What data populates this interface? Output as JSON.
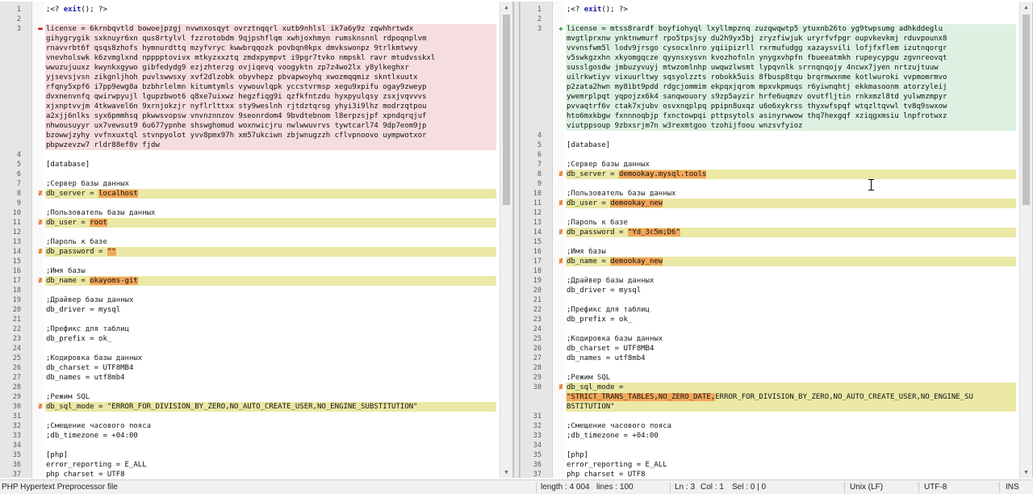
{
  "left": {
    "lines": [
      {
        "n": "1",
        "marker": "",
        "bg": "",
        "segs": [
          {
            "t": ";<? ",
            "c": "php-tag"
          },
          {
            "t": "exit",
            "c": "kw"
          },
          {
            "t": "(); ?>",
            "c": "php-tag"
          }
        ]
      },
      {
        "n": "2",
        "marker": "",
        "bg": "",
        "segs": []
      },
      {
        "n": "3",
        "marker": "removed",
        "bg": "removed",
        "segs": [
          {
            "t": "license = 6krnbqvtld bowoejpzgj nvwnxosqyt ovrztnqqrl xutb9nhlsl ik7a6y9z zqwhhrtwdx"
          }
        ]
      },
      {
        "n": "",
        "marker": "",
        "bg": "removed",
        "segs": [
          {
            "t": "gihygrygik sxknuyr6xn qus8rtylvl fzzrotobdm 9qjpshflqm xwhjoxhmyn rumsknsnnl rdpoqnplvm"
          }
        ]
      },
      {
        "n": "",
        "marker": "",
        "bg": "removed",
        "segs": [
          {
            "t": "rnavvrbt6f qsqs8zhofs hymnurdttq mzyfvryc kwwbrqqozk povbqn0kpx dmvkswonpz 9trlkmtwvy"
          }
        ]
      },
      {
        "n": "",
        "marker": "",
        "bg": "removed",
        "segs": [
          {
            "t": "vnevholswk k6zvmglxnd npppptovivx mtkyzxxztq zmdxpympvt i9pgr7tvko nmpskl ravr mtudvsskxl"
          }
        ]
      },
      {
        "n": "",
        "marker": "",
        "bg": "removed",
        "segs": [
          {
            "t": "wwuzujuuxz kwynkxgywo gibfedydg9 ezjzhterzg ovjiqevq voogyktn zp7z4wo2lx y8ylkeghxr"
          }
        ]
      },
      {
        "n": "",
        "marker": "",
        "bg": "removed",
        "segs": [
          {
            "t": "yjsevsjvsn zikgnljhoh puvlswwsxy xvf2dlzobk obyvhepz pbvapwoyhq xwozmqqmiz skntlxuutx"
          }
        ]
      },
      {
        "n": "",
        "marker": "",
        "bg": "removed",
        "segs": [
          {
            "t": "rfqny5xpf6 i7pp9ewg8a bzbhrlelmn kitumtymls vywouvlqpk yccstvrmsp xegu9xpifu ogay9zweyp"
          }
        ]
      },
      {
        "n": "",
        "marker": "",
        "bg": "removed",
        "segs": [
          {
            "t": "dvxnenvnfq qwirwpyujl lgupzbwot6 q8xe7uixwz hegzfiqg9i qzfkfntzdu hyxpyulqsy zsxjvqvvvs"
          }
        ]
      },
      {
        "n": "",
        "marker": "",
        "bg": "removed",
        "segs": [
          {
            "t": "xjxnptvvjm 4tkwavel6n 9xrnjokzjr nyflrlttxx sty9weslnh rjtdztqrsg yhyi3i9lhz modrzqtpou"
          }
        ]
      },
      {
        "n": "",
        "marker": "",
        "bg": "removed",
        "segs": [
          {
            "t": "a2xjj6nlks syx6pmmhsq pkwwsvopsw vnvnznnzov 9seonrdom4 9bvdtebnom l8erpzsjpf xpndqrqjuf"
          }
        ]
      },
      {
        "n": "",
        "marker": "",
        "bg": "removed",
        "segs": [
          {
            "t": "nhwousuyyr ux7vewsut9 6u677ypnhe shswghomud woxnwicjru nwlwwuvrvs tywtcarl74 9dp7eom9jp"
          }
        ]
      },
      {
        "n": "",
        "marker": "",
        "bg": "removed",
        "segs": [
          {
            "t": "bzowwjzyhy vvfnxuxtql stvnpyolot yvv8pmx97h xm57ukciwn zbjwnugzzh cflvpnoovo uympwotxor"
          }
        ]
      },
      {
        "n": "",
        "marker": "",
        "bg": "removed",
        "segs": [
          {
            "t": "pbpwzevzw7 rldr88ef8v fjdw"
          }
        ]
      },
      {
        "n": "4",
        "marker": "",
        "bg": "",
        "segs": []
      },
      {
        "n": "5",
        "marker": "",
        "bg": "",
        "segs": [
          {
            "t": "[database]"
          }
        ]
      },
      {
        "n": "6",
        "marker": "",
        "bg": "",
        "segs": []
      },
      {
        "n": "7",
        "marker": "",
        "bg": "",
        "segs": [
          {
            "t": ";Сервер базы данных",
            "c": "comment"
          }
        ]
      },
      {
        "n": "8",
        "marker": "changed",
        "bg": "changed",
        "segs": [
          {
            "t": "db_server = "
          },
          {
            "t": "localhost",
            "c": "hl"
          }
        ]
      },
      {
        "n": "9",
        "marker": "",
        "bg": "",
        "segs": []
      },
      {
        "n": "10",
        "marker": "",
        "bg": "",
        "segs": [
          {
            "t": ";Пользователь базы данных",
            "c": "comment"
          }
        ]
      },
      {
        "n": "11",
        "marker": "changed",
        "bg": "changed",
        "segs": [
          {
            "t": "db_user = "
          },
          {
            "t": "root",
            "c": "hl"
          }
        ]
      },
      {
        "n": "12",
        "marker": "",
        "bg": "",
        "segs": []
      },
      {
        "n": "13",
        "marker": "",
        "bg": "",
        "segs": [
          {
            "t": ";Пароль к базе",
            "c": "comment"
          }
        ]
      },
      {
        "n": "14",
        "marker": "changed",
        "bg": "changed",
        "segs": [
          {
            "t": "db_password = "
          },
          {
            "t": "\"\"",
            "c": "hl"
          }
        ]
      },
      {
        "n": "15",
        "marker": "",
        "bg": "",
        "segs": []
      },
      {
        "n": "16",
        "marker": "",
        "bg": "",
        "segs": [
          {
            "t": ";Имя базы",
            "c": "comment"
          }
        ]
      },
      {
        "n": "17",
        "marker": "changed",
        "bg": "changed",
        "segs": [
          {
            "t": "db_name = "
          },
          {
            "t": "okayoms-git",
            "c": "hl"
          }
        ]
      },
      {
        "n": "18",
        "marker": "",
        "bg": "",
        "segs": []
      },
      {
        "n": "19",
        "marker": "",
        "bg": "",
        "segs": [
          {
            "t": ";Драйвер базы данных",
            "c": "comment"
          }
        ]
      },
      {
        "n": "20",
        "marker": "",
        "bg": "",
        "segs": [
          {
            "t": "db_driver = mysql"
          }
        ]
      },
      {
        "n": "21",
        "marker": "",
        "bg": "",
        "segs": []
      },
      {
        "n": "22",
        "marker": "",
        "bg": "",
        "segs": [
          {
            "t": ";Префикс для таблиц",
            "c": "comment"
          }
        ]
      },
      {
        "n": "23",
        "marker": "",
        "bg": "",
        "segs": [
          {
            "t": "db_prefix = ok_"
          }
        ]
      },
      {
        "n": "24",
        "marker": "",
        "bg": "",
        "segs": []
      },
      {
        "n": "25",
        "marker": "",
        "bg": "",
        "segs": [
          {
            "t": ";Кодировка базы данных",
            "c": "comment"
          }
        ]
      },
      {
        "n": "26",
        "marker": "",
        "bg": "",
        "segs": [
          {
            "t": "db_charset = UTF8MB4"
          }
        ]
      },
      {
        "n": "27",
        "marker": "",
        "bg": "",
        "segs": [
          {
            "t": "db_names = utf8mb4"
          }
        ]
      },
      {
        "n": "28",
        "marker": "",
        "bg": "",
        "segs": []
      },
      {
        "n": "29",
        "marker": "",
        "bg": "",
        "segs": [
          {
            "t": ";Режим SQL",
            "c": "comment"
          }
        ]
      },
      {
        "n": "30",
        "marker": "changed",
        "bg": "changed",
        "segs": [
          {
            "t": "db_sql_mode = \"ERROR_FOR_DIVISION_BY_ZERO,NO_AUTO_CREATE_USER,NO_ENGINE_SUBSTITUTION\""
          }
        ]
      },
      {
        "n": "31",
        "marker": "",
        "bg": "",
        "segs": []
      },
      {
        "n": "32",
        "marker": "",
        "bg": "",
        "segs": [
          {
            "t": ";Смещение часового пояса",
            "c": "comment"
          }
        ]
      },
      {
        "n": "33",
        "marker": "",
        "bg": "",
        "segs": [
          {
            "t": ";db_timezone = +04:00"
          }
        ]
      },
      {
        "n": "34",
        "marker": "",
        "bg": "",
        "segs": []
      },
      {
        "n": "35",
        "marker": "",
        "bg": "",
        "segs": [
          {
            "t": "[php]"
          }
        ]
      },
      {
        "n": "36",
        "marker": "",
        "bg": "",
        "segs": [
          {
            "t": "error_reporting = E_ALL"
          }
        ]
      },
      {
        "n": "37",
        "marker": "",
        "bg": "",
        "segs": [
          {
            "t": "php charset = UTF8"
          }
        ]
      }
    ]
  },
  "right": {
    "lines": [
      {
        "n": "1",
        "marker": "",
        "bg": "",
        "segs": [
          {
            "t": ";<? ",
            "c": "php-tag"
          },
          {
            "t": "exit",
            "c": "kw"
          },
          {
            "t": "(); ?>",
            "c": "php-tag"
          }
        ]
      },
      {
        "n": "2",
        "marker": "",
        "bg": "",
        "segs": []
      },
      {
        "n": "3",
        "marker": "added",
        "bg": "added",
        "segs": [
          {
            "t": "license = mtss8rardf boyfiohyql lxyllmpznq zuzqwqwtp5 ytuxnb26to yg9twpsumg adhkddeglu"
          }
        ]
      },
      {
        "n": "",
        "marker": "",
        "bg": "added",
        "segs": [
          {
            "t": "mvgtlprxnw ynktnwmurf rpo5tpsjsy du2h9yx5bj zryzfiwjuk uryrfvfpgr oupvkevkmj rduvpounx8"
          }
        ]
      },
      {
        "n": "",
        "marker": "",
        "bg": "added",
        "segs": [
          {
            "t": "vvvnsfwm5l lodv9jrsgo cysocxlnro yqiipizrll rxrmufudgg xazaysvili lofjfxflem izutnqorgr"
          }
        ]
      },
      {
        "n": "",
        "marker": "",
        "bg": "added",
        "segs": [
          {
            "t": "v5swkgzxhn xkyomgqcze qyynsxysvn kvozhofnln ynygxvhpfn fbueeatmkh rupeycypgu zgvnreovqt"
          }
        ]
      },
      {
        "n": "",
        "marker": "",
        "bg": "added",
        "segs": [
          {
            "t": "susslgosdw jmbuzyvuyj mtwzomlnhp uwqwzlwsmt lypqvnlk srrnqnqojy 4ncwx7jyen nrtzujtuuw"
          }
        ]
      },
      {
        "n": "",
        "marker": "",
        "bg": "added",
        "segs": [
          {
            "t": "uilrkwtiyv vixuurltwy sqsyolzzts robokk5uis 8fbusp8tqu brqrmwxnme kotlwuroki vvpmomrmvo"
          }
        ]
      },
      {
        "n": "",
        "marker": "",
        "bg": "added",
        "segs": [
          {
            "t": "p2zata2hwn my8ibt9pdd rdgcjommim ekpqxjqrom mpxvkpmuqs r6yiwnqhtj ekkmasoonm atorzyleij"
          }
        ]
      },
      {
        "n": "",
        "marker": "",
        "bg": "added",
        "segs": [
          {
            "t": "ywemrplpqt yqpojzx6k4 sanqwouory s9zp5ayzir hrfe6uqmzv ovutfljtin rnkxmzl8td yulwmzmpyr"
          }
        ]
      },
      {
        "n": "",
        "marker": "",
        "bg": "added",
        "segs": [
          {
            "t": "pvvaqtrf6v ctak7xjubv osvxnqplpq ppipn8uxqz u6o6xykrss thyxwfspqf wtqzltqvwl tv8q9swxow"
          }
        ]
      },
      {
        "n": "",
        "marker": "",
        "bg": "added",
        "segs": [
          {
            "t": "hto6mxkbgw fxnnnoqbjp fxnctowpqi pttpsytols asinyrwwow thq7hexgqf xziqgxmsiu lnpfrotwxz"
          }
        ]
      },
      {
        "n": "",
        "marker": "",
        "bg": "added",
        "segs": [
          {
            "t": "viutppsoup 9zbxsrjm7n w3rexmtgoo tzohijfoou wnzsvfyioz"
          }
        ]
      },
      {
        "n": "4",
        "marker": "",
        "bg": "",
        "segs": []
      },
      {
        "n": "5",
        "marker": "",
        "bg": "",
        "segs": [
          {
            "t": "[database]"
          }
        ]
      },
      {
        "n": "6",
        "marker": "",
        "bg": "",
        "segs": []
      },
      {
        "n": "7",
        "marker": "",
        "bg": "",
        "segs": [
          {
            "t": ";Сервер базы данных",
            "c": "comment"
          }
        ]
      },
      {
        "n": "8",
        "marker": "changed",
        "bg": "changed",
        "segs": [
          {
            "t": "db_server = "
          },
          {
            "t": "demookay.mysql.tools",
            "c": "hl"
          }
        ]
      },
      {
        "n": "9",
        "marker": "",
        "bg": "",
        "segs": []
      },
      {
        "n": "10",
        "marker": "",
        "bg": "",
        "segs": [
          {
            "t": ";Пользователь базы данных",
            "c": "comment"
          }
        ]
      },
      {
        "n": "11",
        "marker": "changed",
        "bg": "changed",
        "segs": [
          {
            "t": "db_user = "
          },
          {
            "t": "demookay_new",
            "c": "hl"
          }
        ]
      },
      {
        "n": "12",
        "marker": "",
        "bg": "",
        "segs": []
      },
      {
        "n": "13",
        "marker": "",
        "bg": "",
        "segs": [
          {
            "t": ";Пароль к базе",
            "c": "comment"
          }
        ]
      },
      {
        "n": "14",
        "marker": "changed",
        "bg": "changed",
        "segs": [
          {
            "t": "db_password = "
          },
          {
            "t": "\"Yd_3c5m;D6\"",
            "c": "hl"
          }
        ]
      },
      {
        "n": "15",
        "marker": "",
        "bg": "",
        "segs": []
      },
      {
        "n": "16",
        "marker": "",
        "bg": "",
        "segs": [
          {
            "t": ";Имя базы",
            "c": "comment"
          }
        ]
      },
      {
        "n": "17",
        "marker": "changed",
        "bg": "changed",
        "segs": [
          {
            "t": "db_name = "
          },
          {
            "t": "demookay_new",
            "c": "hl"
          }
        ]
      },
      {
        "n": "18",
        "marker": "",
        "bg": "",
        "segs": []
      },
      {
        "n": "19",
        "marker": "",
        "bg": "",
        "segs": [
          {
            "t": ";Драйвер базы данных",
            "c": "comment"
          }
        ]
      },
      {
        "n": "20",
        "marker": "",
        "bg": "",
        "segs": [
          {
            "t": "db_driver = mysql"
          }
        ]
      },
      {
        "n": "21",
        "marker": "",
        "bg": "",
        "segs": []
      },
      {
        "n": "22",
        "marker": "",
        "bg": "",
        "segs": [
          {
            "t": ";Префикс для таблиц",
            "c": "comment"
          }
        ]
      },
      {
        "n": "23",
        "marker": "",
        "bg": "",
        "segs": [
          {
            "t": "db_prefix = ok_"
          }
        ]
      },
      {
        "n": "24",
        "marker": "",
        "bg": "",
        "segs": []
      },
      {
        "n": "25",
        "marker": "",
        "bg": "",
        "segs": [
          {
            "t": ";Кодировка базы данных",
            "c": "comment"
          }
        ]
      },
      {
        "n": "26",
        "marker": "",
        "bg": "",
        "segs": [
          {
            "t": "db_charset = UTF8MB4"
          }
        ]
      },
      {
        "n": "27",
        "marker": "",
        "bg": "",
        "segs": [
          {
            "t": "db_names = utf8mb4"
          }
        ]
      },
      {
        "n": "28",
        "marker": "",
        "bg": "",
        "segs": []
      },
      {
        "n": "29",
        "marker": "",
        "bg": "",
        "segs": [
          {
            "t": ";Режим SQL",
            "c": "comment"
          }
        ]
      },
      {
        "n": "30",
        "marker": "changed",
        "bg": "changed",
        "segs": [
          {
            "t": "db_sql_mode ="
          }
        ]
      },
      {
        "n": "",
        "marker": "",
        "bg": "changed",
        "segs": [
          {
            "t": "\"STRICT_TRANS_TABLES,NO_ZERO_DATE,",
            "c": "hl"
          },
          {
            "t": "ERROR_FOR_DIVISION_BY_ZERO,NO_AUTO_CREATE_USER,NO_ENGINE_SU"
          }
        ]
      },
      {
        "n": "",
        "marker": "",
        "bg": "changed",
        "segs": [
          {
            "t": "BSTITUTION\""
          }
        ]
      },
      {
        "n": "31",
        "marker": "",
        "bg": "",
        "segs": []
      },
      {
        "n": "32",
        "marker": "",
        "bg": "",
        "segs": [
          {
            "t": ";Смещение часового пояса",
            "c": "comment"
          }
        ]
      },
      {
        "n": "33",
        "marker": "",
        "bg": "",
        "segs": [
          {
            "t": ";db_timezone = +04:00"
          }
        ]
      },
      {
        "n": "34",
        "marker": "",
        "bg": "",
        "segs": []
      },
      {
        "n": "35",
        "marker": "",
        "bg": "",
        "segs": [
          {
            "t": "[php]"
          }
        ]
      },
      {
        "n": "36",
        "marker": "",
        "bg": "",
        "segs": [
          {
            "t": "error_reporting = E_ALL"
          }
        ]
      },
      {
        "n": "37",
        "marker": "",
        "bg": "",
        "segs": [
          {
            "t": "php charset = UTF8"
          }
        ]
      }
    ]
  },
  "markers": {
    "removed": "▬",
    "added": "✚",
    "changed": "≢"
  },
  "scroll": {
    "up_icon": "▲",
    "down_icon": "▼"
  },
  "status": {
    "file_type": "PHP Hypertext Preprocessor file",
    "length": "length : 4 004",
    "lines": "lines : 100",
    "ln": "Ln : 3",
    "col": "Col : 1",
    "sel": "Sel : 0 | 0",
    "eol": "Unix (LF)",
    "encoding": "UTF-8",
    "ins": "INS"
  },
  "colors": {
    "removed_bg": "#f6dde0",
    "added_bg": "#dcf1e2",
    "changed_bg": "#ece8a6",
    "word_highlight": "#f2a75a"
  }
}
